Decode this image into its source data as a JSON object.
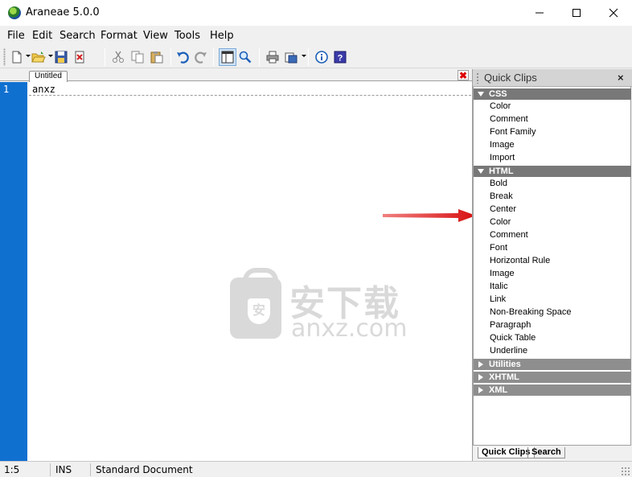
{
  "window": {
    "title": "Araneae 5.0.0"
  },
  "menu": [
    "File",
    "Edit",
    "Search",
    "Format",
    "View",
    "Tools",
    "Help"
  ],
  "toolbar": {
    "buttons": [
      "new-document",
      "open-folder",
      "save",
      "close-document",
      "cut",
      "copy",
      "paste",
      "undo",
      "redo",
      "toggle-panel",
      "find",
      "print",
      "preview",
      "about",
      "help"
    ]
  },
  "editor": {
    "tab_label": "Untitled",
    "line_number": "1",
    "content": "anxz"
  },
  "watermark": {
    "cn": "安下载",
    "en": "anxz.com",
    "shield": "安"
  },
  "quick_clips": {
    "title": "Quick Clips",
    "close": "×",
    "categories": [
      {
        "name": "CSS",
        "expanded": true,
        "items": [
          "Color",
          "Comment",
          "Font Family",
          "Image",
          "Import"
        ]
      },
      {
        "name": "HTML",
        "expanded": true,
        "items": [
          "Bold",
          "Break",
          "Center",
          "Color",
          "Comment",
          "Font",
          "Horizontal Rule",
          "Image",
          "Italic",
          "Link",
          "Non-Breaking Space",
          "Paragraph",
          "Quick Table",
          "Underline"
        ]
      },
      {
        "name": "Utilities",
        "expanded": false,
        "items": []
      },
      {
        "name": "XHTML",
        "expanded": false,
        "items": []
      },
      {
        "name": "XML",
        "expanded": false,
        "items": []
      }
    ],
    "tabs": [
      "Quick Clips",
      "Search"
    ]
  },
  "status": {
    "position": "1:5",
    "mode": "INS",
    "doc_type": "Standard Document"
  },
  "colors": {
    "gutter": "#1070d0",
    "category_bar": "#787878",
    "arrow": "#e02020"
  }
}
